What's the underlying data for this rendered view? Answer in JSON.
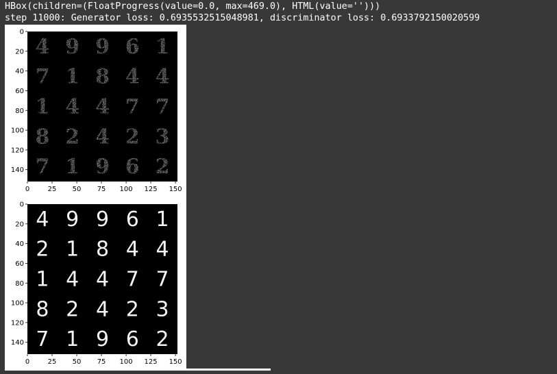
{
  "output": {
    "widget_repr": "HBox(children=(FloatProgress(value=0.0, max=469.0), HTML(value='')))",
    "step_log": "step 11000: Generator loss: 0.6935532515048981, discriminator loss: 0.6933792150020599"
  },
  "plots": {
    "x_ticks": [
      "0",
      "25",
      "50",
      "75",
      "100",
      "125",
      "150"
    ],
    "y_ticks": [
      "0",
      "20",
      "40",
      "60",
      "80",
      "100",
      "120",
      "140"
    ],
    "generated_digits": [
      "4",
      "9",
      "9",
      "6",
      "1",
      "7",
      "1",
      "8",
      "4",
      "4",
      "1",
      "4",
      "4",
      "7",
      "7",
      "8",
      "2",
      "4",
      "2",
      "3",
      "7",
      "1",
      "9",
      "6",
      "2"
    ],
    "real_digits": [
      "4",
      "9",
      "9",
      "6",
      "1",
      "2",
      "1",
      "8",
      "4",
      "4",
      "1",
      "4",
      "4",
      "7",
      "7",
      "8",
      "2",
      "4",
      "2",
      "3",
      "7",
      "1",
      "9",
      "6",
      "2"
    ]
  }
}
